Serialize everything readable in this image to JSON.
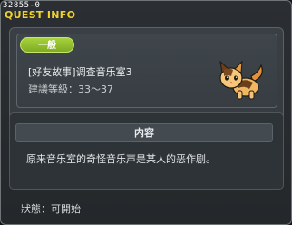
{
  "window": {
    "id": "32855-0",
    "title": "QUEST INFO"
  },
  "quest": {
    "category": "一般",
    "name": "[好友故事]调查音乐室3",
    "level_requirement": "建議等級：33～37",
    "icon": "cat-icon"
  },
  "content": {
    "header": "内容",
    "text": "原来音乐室的奇怪音乐声是某人的恶作剧。"
  },
  "status": {
    "text": "狀態：可開始"
  },
  "colors": {
    "title": "#f0d22a",
    "category_pill": "#8fbe2b"
  }
}
